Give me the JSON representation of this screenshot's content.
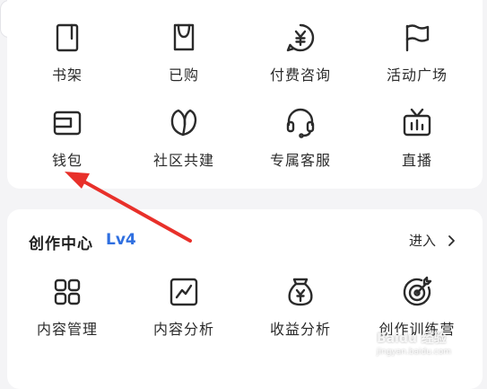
{
  "colors": {
    "background": "#f4f4f6",
    "card": "#ffffff",
    "text": "#2b2b2b",
    "level_accent": "#2f6fe0",
    "annotation_arrow": "#e8302a"
  },
  "quick_tools": {
    "row1": [
      {
        "label": "书架",
        "icon": "bookshelf-icon"
      },
      {
        "label": "已购",
        "icon": "shopping-bag-icon"
      },
      {
        "label": "付费咨询",
        "icon": "paid-consult-icon"
      },
      {
        "label": "活动广场",
        "icon": "flag-icon"
      }
    ],
    "row2": [
      {
        "label": "钱包",
        "icon": "wallet-icon"
      },
      {
        "label": "社区共建",
        "icon": "leaf-icon"
      },
      {
        "label": "专属客服",
        "icon": "headset-icon"
      },
      {
        "label": "直播",
        "icon": "tv-icon"
      }
    ]
  },
  "creation_center": {
    "title": "创作中心",
    "level": "Lv4",
    "enter_label": "进入",
    "items": [
      {
        "label": "内容管理",
        "icon": "grid-icon"
      },
      {
        "label": "内容分析",
        "icon": "line-chart-icon"
      },
      {
        "label": "收益分析",
        "icon": "money-bag-icon"
      },
      {
        "label": "创作训练营",
        "icon": "target-icon"
      }
    ]
  },
  "watermark": {
    "line1": "Baidu 经验",
    "line2": "jingyan.baidu.com"
  }
}
